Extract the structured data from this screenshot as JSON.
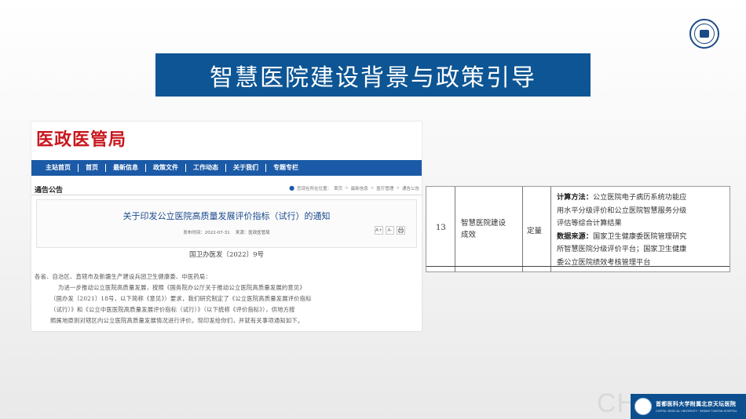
{
  "slide": {
    "title": "智慧医院建设背景与政策引导",
    "watermark": "CH",
    "colors": {
      "title_bg": "#0d5594",
      "nav_bg": "#1b5aa6",
      "site_red": "#c9171e"
    }
  },
  "webpage": {
    "site_title": "医政医管局",
    "nav": [
      "主站首页",
      "首页",
      "最新信息",
      "政策文件",
      "工作动态",
      "关于我们",
      "专题专栏"
    ],
    "section": "通告公告",
    "breadcrumb": {
      "location_label": "您现在所在位置：",
      "items": [
        "首页",
        "最新信息",
        "医疗管理",
        "通告公告"
      ]
    },
    "article": {
      "title": "关于印发公立医院高质量发展评价指标（试行）的通知",
      "meta_date": "发布时间：2022-07-31",
      "meta_source": "来源：医政医管局",
      "tools": [
        "A+",
        "A-",
        "print-icon"
      ],
      "doc_number": "国卫办医发〔2022〕9号",
      "body": [
        "各省、自治区、直辖市及新疆生产建设兵团卫生健康委、中医药局：",
        "为进一步推动公立医院高质量发展，按照《国务院办公厅关于推动公立医院高质量发展的意见》",
        "（国办发〔2021〕18号，以下简称《意见》）要求，我们研究制定了《公立医院高质量发展评价指标",
        "（试行）》和《公立中医医院高质量发展评价指标（试行）》（以下统称《评价指标》），供地方按",
        "照属地原则对辖区内公立医院高质量发展情况进行评价。现印发给你们，并就有关事项通知如下。"
      ]
    }
  },
  "table_row": {
    "number": "13",
    "name_lines": [
      "智慧医院建设",
      "成效"
    ],
    "type": "定量",
    "method_label": "计算方法：",
    "method_lines": [
      "公立医院电子病历系统功能应",
      "用水平分级评价和公立医院智慧服务分级",
      "评估等综合计算结果"
    ],
    "source_label": "数据来源：",
    "source_lines": [
      "国家卫生健康委医院管理研究",
      "所智慧医院分级评价平台；国家卫生健康",
      "委公立医院绩效考核管理平台"
    ]
  },
  "footer": {
    "hospital_cn": "首都医科大学附属北京天坛医院",
    "hospital_en": "CAPITAL MEDICAL UNIVERSITY · BEIJING TIANTAN HOSPITAL"
  }
}
